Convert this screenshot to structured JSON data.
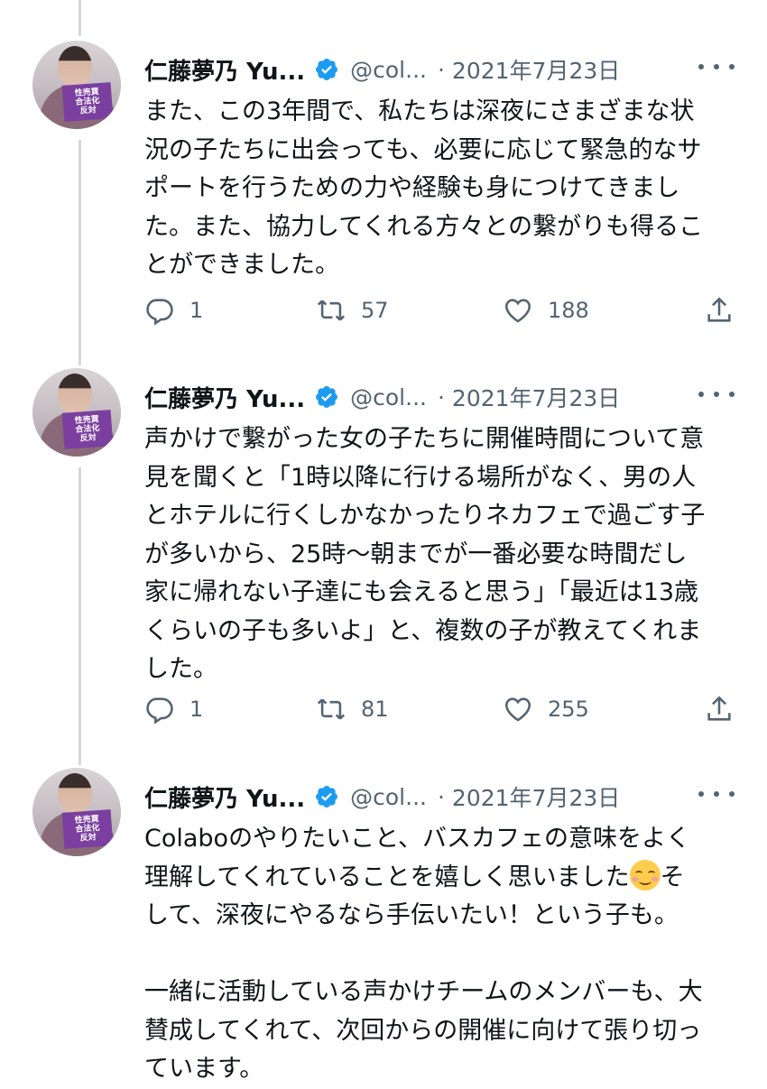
{
  "tweets": [
    {
      "author": "仁藤夢乃 Yu...",
      "handle": "@col...",
      "separator": "·",
      "date": "2021年7月23日",
      "avatar_sign": [
        "性売買",
        "合法化",
        "反対"
      ],
      "text": "また、この3年間で、私たちは深夜にさまざまな状\n況の子たちに出会っても、必要に応じて緊急的なサ\nポートを行うための力や経験も身につけてきまし\nた。また、協力してくれる方々との繋がりも得るこ\nとができました。",
      "replies": "1",
      "retweets": "57",
      "likes": "188"
    },
    {
      "author": "仁藤夢乃 Yu...",
      "handle": "@col...",
      "separator": "·",
      "date": "2021年7月23日",
      "avatar_sign": [
        "性売買",
        "合法化",
        "反対"
      ],
      "text": "声かけで繋がった女の子たちに開催時間について意\n見を聞くと「1時以降に行ける場所がなく、男の人\nとホテルに行くしかなかったりネカフェで過ごす子\nが多いから、25時〜朝までが一番必要な時間だし\n家に帰れない子達にも会えると思う」「最近は13歳\nくらいの子も多いよ」と、複数の子が教えてくれま\nした。",
      "replies": "1",
      "retweets": "81",
      "likes": "255"
    },
    {
      "author": "仁藤夢乃 Yu...",
      "handle": "@col...",
      "separator": "·",
      "date": "2021年7月23日",
      "avatar_sign": [
        "性売買",
        "合法化",
        "反対"
      ],
      "text_line1": "Colaboのやりたいこと、バスカフェの意味をよく",
      "text_line2a": "理解してくれていることを嬉しく思いました",
      "emoji": "smiling-face-with-smiling-eyes",
      "text_line2b": "そ",
      "text_rest": "して、深夜にやるなら手伝いたい！という子も。\n\n一緒に活動している声かけチームのメンバーも、大\n賛成してくれて、次回からの開催に向けて張り切っ\nています。"
    }
  ],
  "colors": {
    "text": "#0f1419",
    "secondary": "#536471",
    "verified": "#1d9bf0",
    "thread_line": "#cfd9de"
  }
}
